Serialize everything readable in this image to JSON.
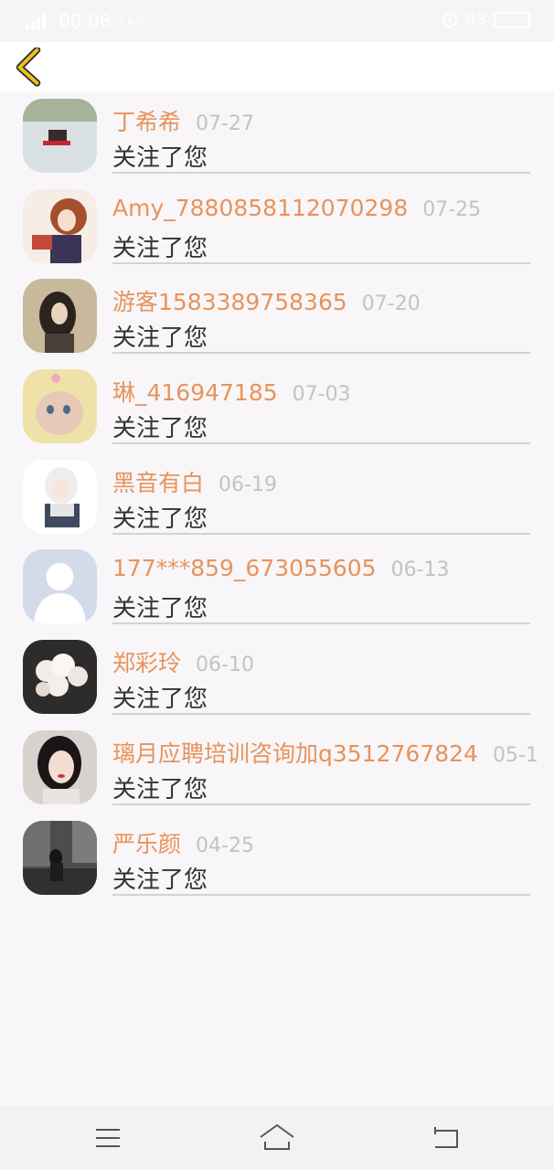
{
  "status_bar": {
    "time": "00:06",
    "network_speed": "1 K/s",
    "battery": "93"
  },
  "icons": {
    "back": "chevron-left-icon",
    "menu": "menu-icon",
    "home": "home-icon",
    "return": "back-arrow-icon"
  },
  "colors": {
    "name": "#e8935c",
    "date": "#c3c3c3",
    "accent": "#f0c419"
  },
  "notifications": [
    {
      "name": "丁希希",
      "date": "07-27",
      "message": "关注了您"
    },
    {
      "name": "Amy_7880858112070298",
      "date": "07-25",
      "message": "关注了您"
    },
    {
      "name": "游客1583389758365",
      "date": "07-20",
      "message": "关注了您"
    },
    {
      "name": "琳_416947185",
      "date": "07-03",
      "message": "关注了您"
    },
    {
      "name": "黑音有白",
      "date": "06-19",
      "message": "关注了您"
    },
    {
      "name": "177***859_673055605",
      "date": "06-13",
      "message": "关注了您"
    },
    {
      "name": "郑彩玲",
      "date": "06-10",
      "message": "关注了您"
    },
    {
      "name": "璃月应聘培训咨询加q3512767824",
      "date": "05-1",
      "message": "关注了您"
    },
    {
      "name": "严乐颜",
      "date": "04-25",
      "message": "关注了您"
    }
  ]
}
